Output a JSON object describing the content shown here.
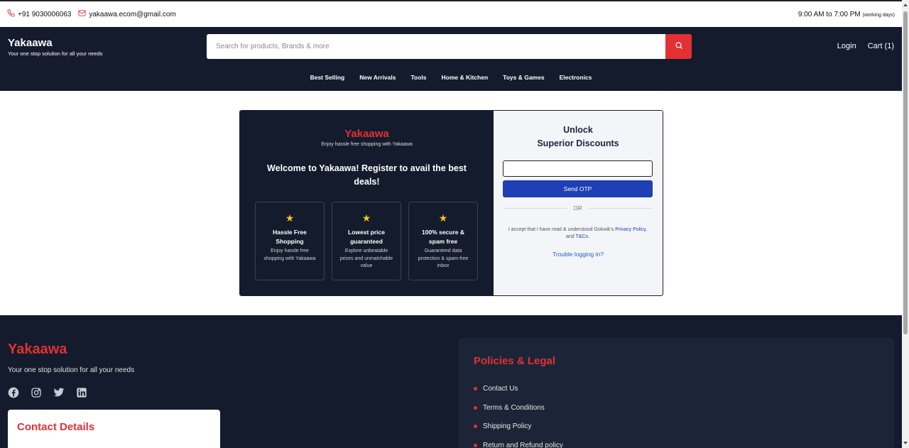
{
  "topbar": {
    "phone": "+91 9030006063",
    "email": "yakaawa.ecom@gmail.com",
    "hours": "9:00 AM to 7:00 PM",
    "hours_note": "(working days)"
  },
  "header": {
    "brand": "Yakaawa",
    "tagline": "Your one stop solution for all your needs",
    "search_placeholder": "Search for products, Brands & more",
    "login": "Login",
    "cart": "Cart (1)",
    "nav": [
      "Best Selling",
      "New Arrivals",
      "Tools",
      "Home & Kitchen",
      "Toys & Games",
      "Electronics"
    ]
  },
  "login_card": {
    "brand": "Yakaawa",
    "brand_sub": "Enjoy hassle free shopping with Yakaawa",
    "welcome": "Welcome to Yakaawa! Register to avail the best deals!",
    "features": [
      {
        "title": "Hassle Free Shopping",
        "desc": "Enjoy hassle free shopping with Yakaawa"
      },
      {
        "title": "Lowest price guaranteed",
        "desc": "Explore unbeatable prices and unmatchable value"
      },
      {
        "title": "100% secure & spam free",
        "desc": "Guaranteed data protection & spam-free inbox"
      }
    ],
    "title_line1": "Unlock",
    "title_line2": "Superior Discounts",
    "send_otp": "Send OTP",
    "or": "OR",
    "accept_prefix": "I accept that I have read & understood Gokwik's",
    "privacy": "Privacy Policy",
    "and": "and",
    "tnc": "T&Cs.",
    "trouble": "Trouble logging in?"
  },
  "footer": {
    "brand": "Yakaawa",
    "tagline": "Your one stop solution for all your needs",
    "social": [
      "facebook-icon",
      "instagram-icon",
      "twitter-icon",
      "linkedin-icon"
    ],
    "contact_heading": "Contact Details",
    "policies_heading": "Policies & Legal",
    "policies": [
      "Contact Us",
      "Terms & Conditions",
      "Shipping Policy",
      "Return and Refund policy"
    ]
  },
  "colors": {
    "dark": "#141b2d",
    "accent": "#e33033",
    "primary_button": "#1f3fb4"
  }
}
